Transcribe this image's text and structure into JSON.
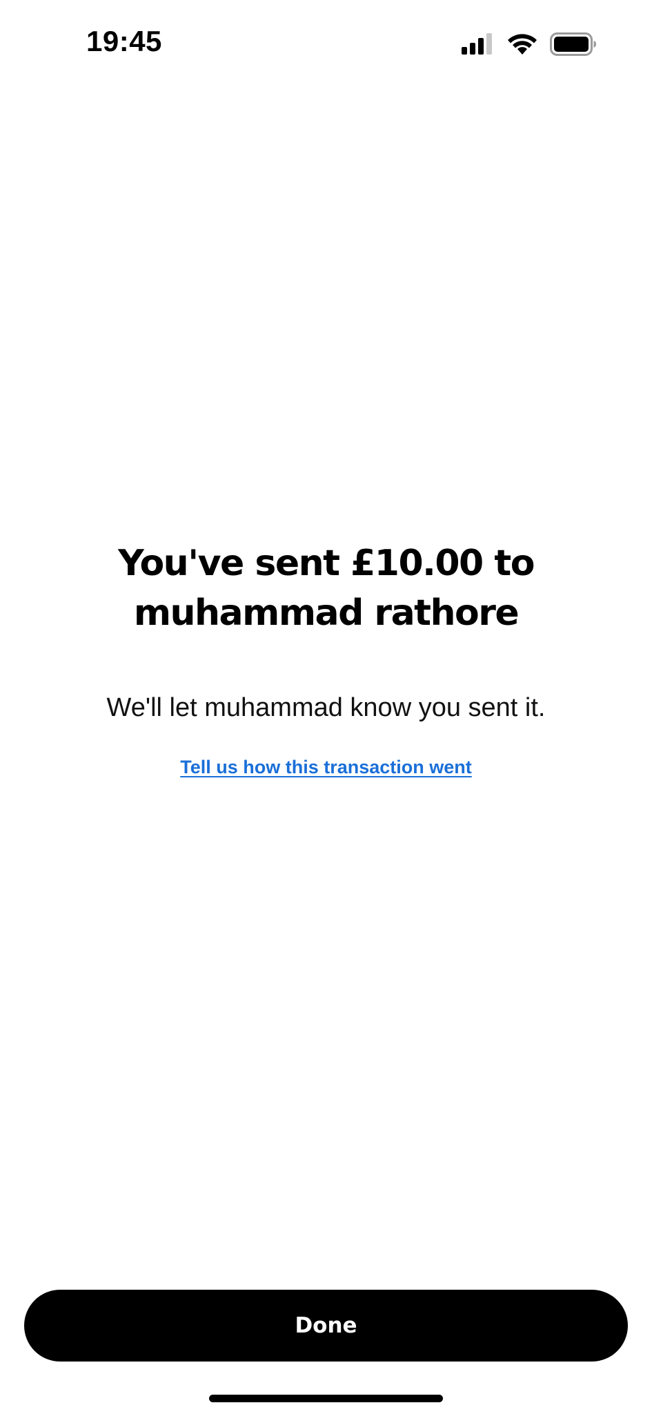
{
  "status_bar": {
    "time": "19:45",
    "icons": [
      "cellular-signal-icon",
      "wifi-icon",
      "battery-icon"
    ]
  },
  "confirmation": {
    "headline": "You've sent £10.00 to muhammad rathore",
    "subtext": "We'll let muhammad know you sent it.",
    "feedback_link": "Tell us how this transaction went"
  },
  "actions": {
    "done_label": "Done"
  },
  "colors": {
    "link": "#1a6fd8",
    "button_bg": "#000000",
    "button_text": "#ffffff",
    "background": "#ffffff"
  }
}
